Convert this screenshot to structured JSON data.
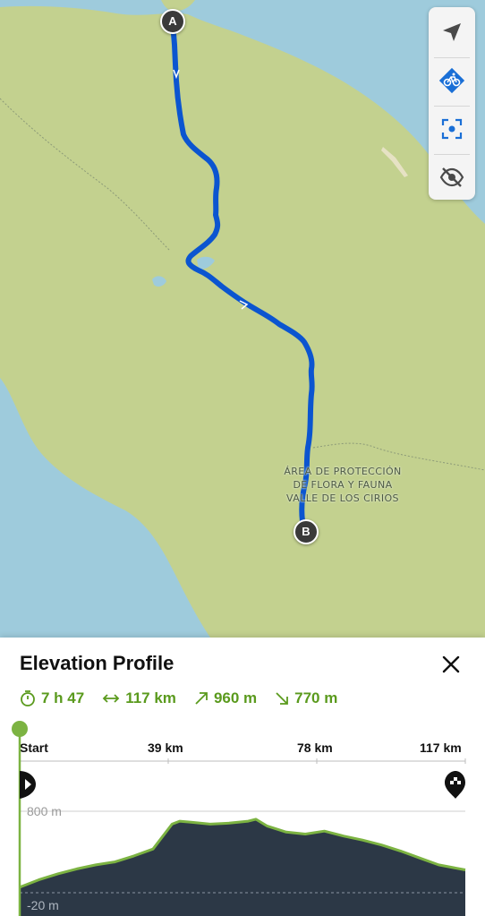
{
  "map": {
    "area_label_lines": [
      "ÁREA DE PROTECCIÓN",
      "DE FLORA Y FAUNA",
      "VALLE DE LOS CIRIOS"
    ],
    "start_marker": "A",
    "end_marker": "B",
    "route_color": "#0b55d0",
    "land_color": "#c3d18f",
    "water_color": "#9ecbdc"
  },
  "controls": {
    "items": [
      "navigation-arrow-icon",
      "cycling-mode-icon",
      "center-route-icon",
      "hide-eye-icon"
    ],
    "accent": "#1a6fd6"
  },
  "panel": {
    "title": "Elevation Profile",
    "close_icon": "close-icon",
    "stats": {
      "duration": "7 h 47",
      "distance": "117 km",
      "ascent": "960 m",
      "descent": "770 m"
    },
    "accent": "#5a9a1d"
  },
  "chart_data": {
    "type": "area",
    "x_ticks": [
      "Start",
      "39 km",
      "78 km",
      "117 km"
    ],
    "y_ticks": [
      "800 m",
      "-20 m"
    ],
    "ylim": [
      -20,
      800
    ],
    "xlim": [
      0,
      117
    ],
    "x": [
      0,
      5,
      10,
      15,
      20,
      25,
      30,
      35,
      40,
      42,
      45,
      50,
      55,
      60,
      62,
      65,
      70,
      75,
      80,
      85,
      90,
      95,
      100,
      105,
      110,
      117
    ],
    "y": [
      35,
      110,
      170,
      220,
      260,
      290,
      350,
      420,
      670,
      700,
      690,
      670,
      680,
      700,
      720,
      650,
      590,
      570,
      600,
      550,
      510,
      460,
      400,
      330,
      260,
      210
    ],
    "fill_color": "#2c3846",
    "line_color": "#7cb342"
  }
}
